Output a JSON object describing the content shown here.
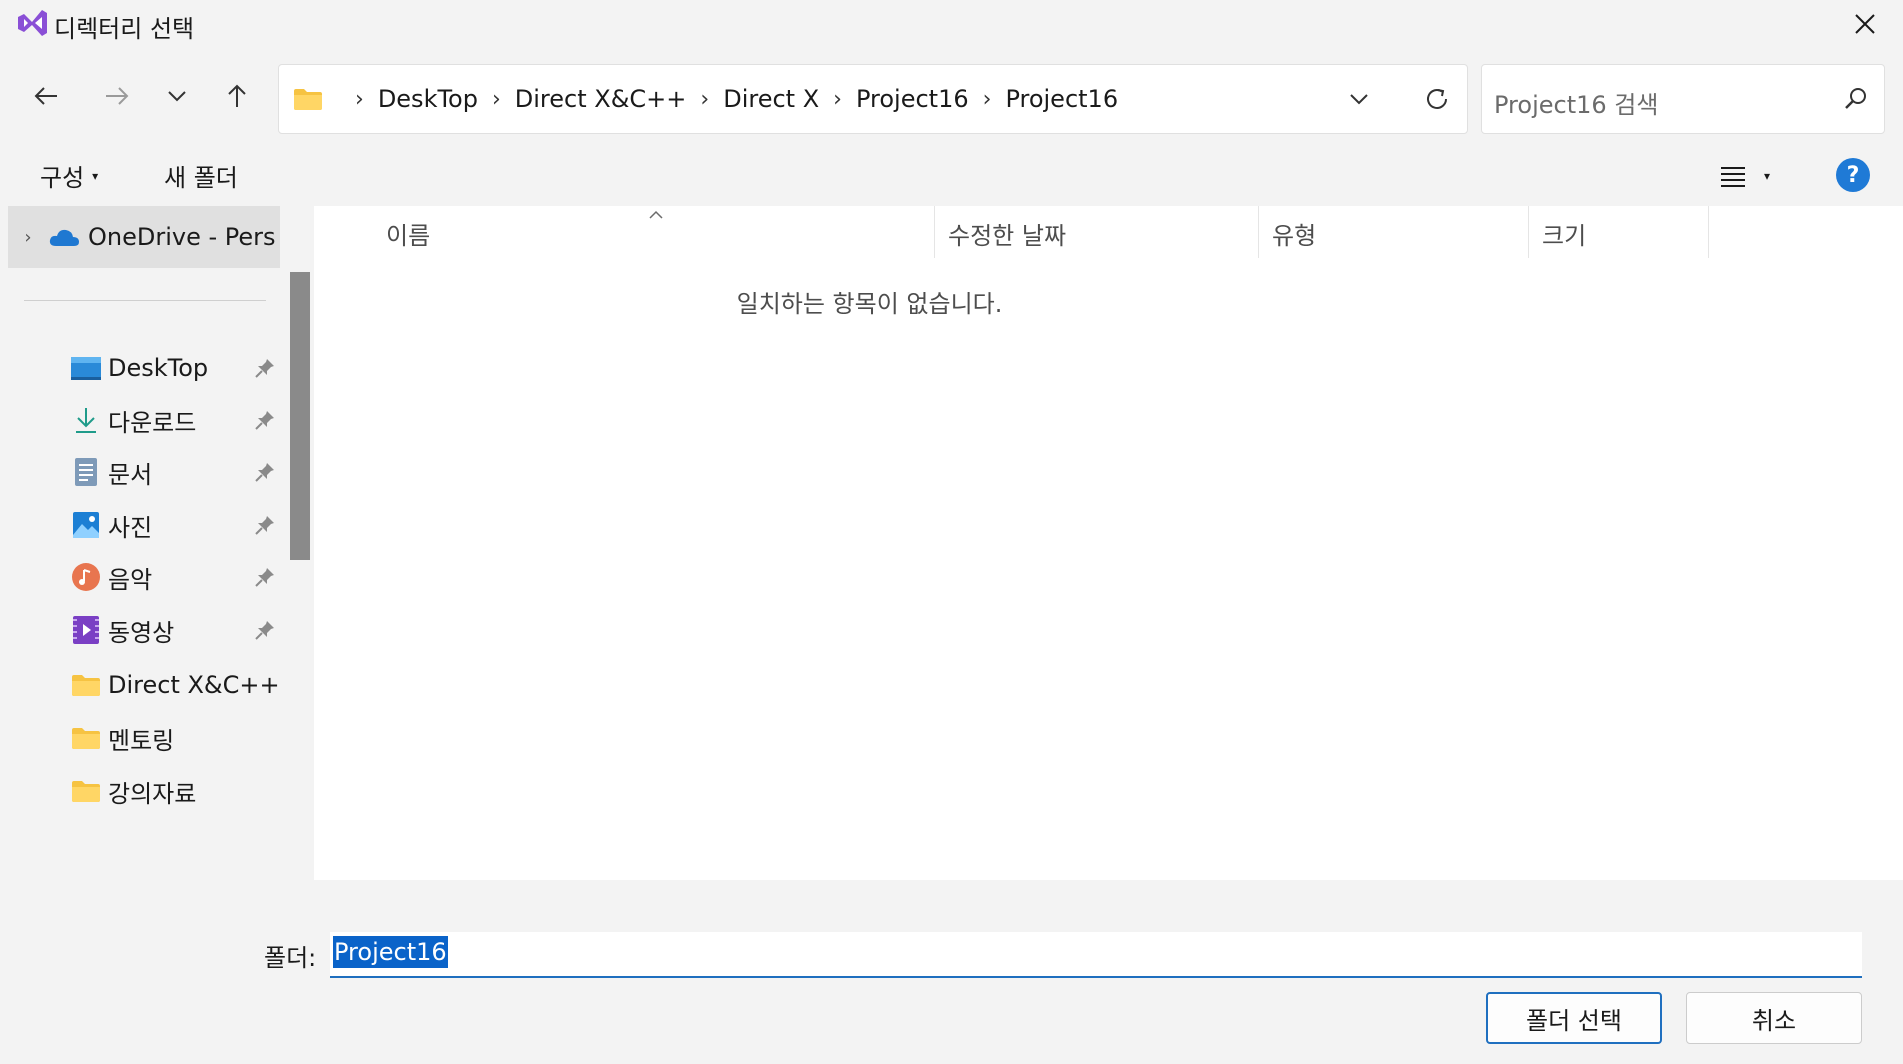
{
  "window": {
    "title": "디렉터리 선택"
  },
  "address": {
    "crumbs": [
      "DeskTop",
      "Direct X&C++",
      "Direct X",
      "Project16",
      "Project16"
    ]
  },
  "search": {
    "placeholder": "Project16 검색"
  },
  "commands": {
    "organize": "구성",
    "new_folder": "새 폴더"
  },
  "nav": {
    "onedrive": "OneDrive - Pers",
    "items": [
      {
        "label": "DeskTop",
        "icon": "desktop-icon",
        "pinned": true
      },
      {
        "label": "다운로드",
        "icon": "download-icon",
        "pinned": true
      },
      {
        "label": "문서",
        "icon": "document-icon",
        "pinned": true
      },
      {
        "label": "사진",
        "icon": "pictures-icon",
        "pinned": true
      },
      {
        "label": "음악",
        "icon": "music-icon",
        "pinned": true
      },
      {
        "label": "동영상",
        "icon": "video-icon",
        "pinned": true
      },
      {
        "label": "Direct X&C++",
        "icon": "folder-icon",
        "pinned": false
      },
      {
        "label": "멘토링",
        "icon": "folder-icon",
        "pinned": false
      },
      {
        "label": "강의자료",
        "icon": "folder-icon",
        "pinned": false
      }
    ]
  },
  "columns": {
    "name": "이름",
    "modified": "수정한 날짜",
    "type": "유형",
    "size": "크기"
  },
  "list": {
    "empty_message": "일치하는 항목이 없습니다."
  },
  "bottom": {
    "folder_label": "폴더:",
    "folder_value": "Project16",
    "select_button": "폴더 선택",
    "cancel_button": "취소"
  },
  "colors": {
    "accent": "#1f6fbf",
    "selection": "#0a63c9",
    "help": "#1f7ad6"
  }
}
